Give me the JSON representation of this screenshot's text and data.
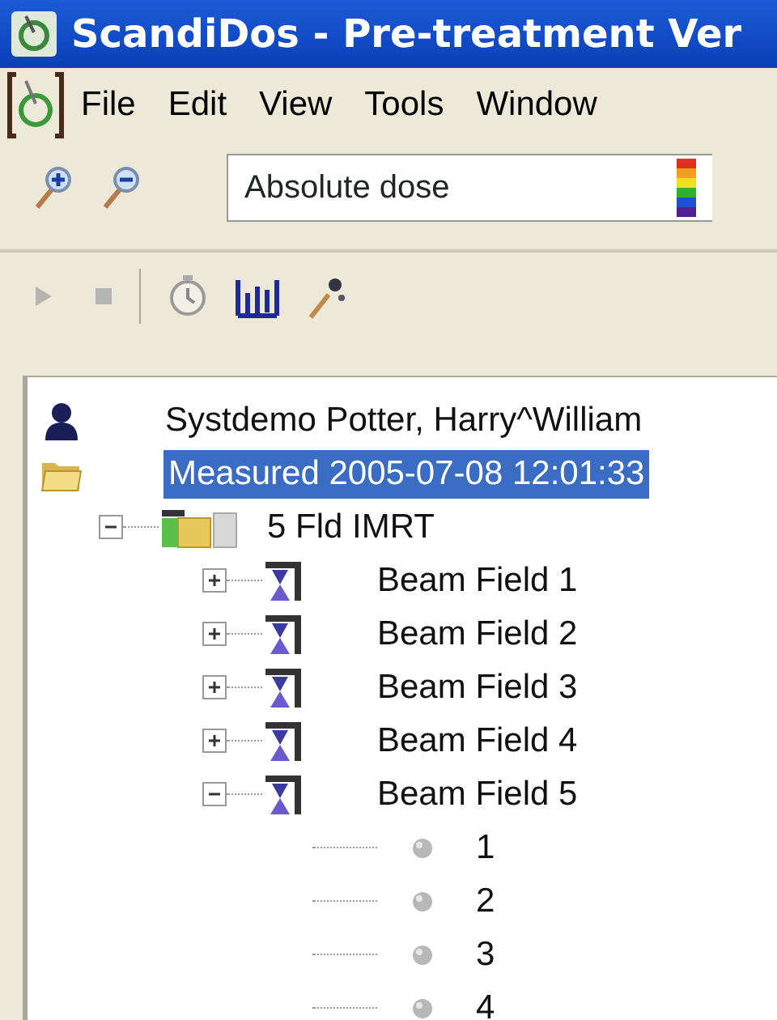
{
  "window": {
    "title": "ScandiDos - Pre-treatment Ver"
  },
  "menu": [
    {
      "label": "File"
    },
    {
      "label": "Edit"
    },
    {
      "label": "View"
    },
    {
      "label": "Tools"
    },
    {
      "label": "Window"
    }
  ],
  "dose_mode": {
    "value": "Absolute dose"
  },
  "tree": [
    {
      "kind": "patient",
      "label": "Systdemo  Potter, Harry^William",
      "selected": false
    },
    {
      "kind": "measurement",
      "label": "Measured  2005-07-08 12:01:33",
      "selected": true,
      "children": [
        {
          "kind": "plan",
          "label": "5 Fld IMRT",
          "selected": false,
          "expanded": true,
          "children": [
            {
              "kind": "beam",
              "label": "Beam Field 1",
              "selected": false,
              "expanded": false
            },
            {
              "kind": "beam",
              "label": "Beam Field 2",
              "selected": false,
              "expanded": false
            },
            {
              "kind": "beam",
              "label": "Beam Field 3",
              "selected": false,
              "expanded": false
            },
            {
              "kind": "beam",
              "label": "Beam Field 4",
              "selected": false,
              "expanded": false
            },
            {
              "kind": "beam",
              "label": "Beam Field 5",
              "selected": false,
              "expanded": true,
              "children": [
                {
                  "kind": "segment",
                  "label": "1",
                  "selected": false
                },
                {
                  "kind": "segment",
                  "label": "2",
                  "selected": false
                },
                {
                  "kind": "segment",
                  "label": "3",
                  "selected": false
                },
                {
                  "kind": "segment",
                  "label": "4",
                  "selected": false
                }
              ]
            }
          ]
        }
      ]
    }
  ]
}
